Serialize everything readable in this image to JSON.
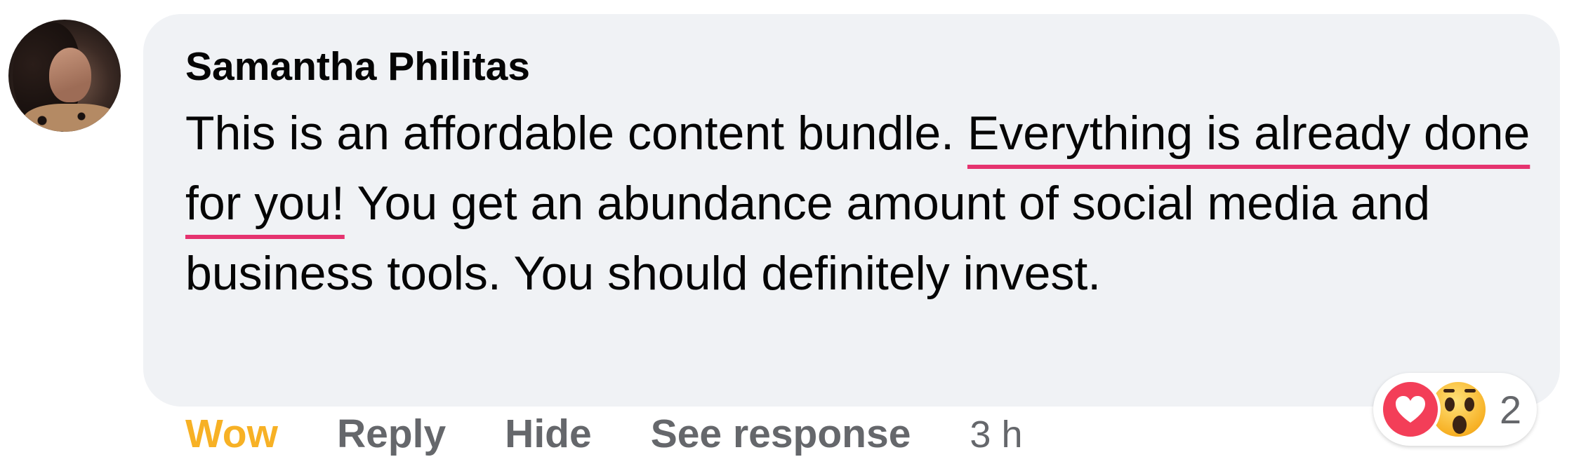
{
  "comment": {
    "author": "Samantha Philitas",
    "text_parts": [
      "This is an affordable content bundle. ",
      "Everything is already done for you!",
      " You get an abundance amount of social media and business tools. You should definitely invest."
    ]
  },
  "reactions": {
    "icons": [
      "love-icon",
      "wow-icon"
    ],
    "count": "2",
    "love_color": "#f33e58",
    "wow_color": "#f7b125"
  },
  "actions": {
    "wow": "Wow",
    "reply": "Reply",
    "hide": "Hide",
    "see_response": "See response",
    "timestamp": "3 h"
  },
  "colors": {
    "bubble": "#f0f2f5",
    "underline": "#e5336f",
    "secondary_text": "#65676b",
    "active_reaction": "#f7b125"
  }
}
